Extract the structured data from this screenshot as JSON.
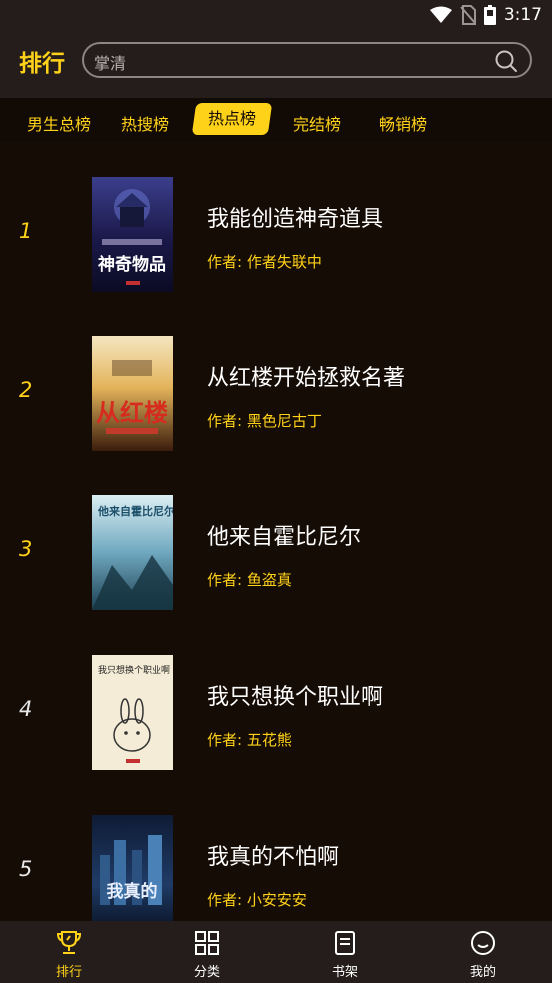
{
  "status_bar": {
    "time": "3:17",
    "icons": [
      "wifi-icon",
      "no-sim-icon",
      "battery-icon"
    ]
  },
  "header": {
    "title": "排行"
  },
  "search": {
    "text": "掌清",
    "icon": "search-icon"
  },
  "tabs": [
    {
      "label": "男生总榜",
      "active": false
    },
    {
      "label": "热搜榜",
      "active": false
    },
    {
      "label": "热点榜",
      "active": true
    },
    {
      "label": "完结榜",
      "active": false
    },
    {
      "label": "畅销榜",
      "active": false
    }
  ],
  "books": [
    {
      "rank": "1",
      "title": "我能创造神奇道具",
      "author": "作者: 作者失联中",
      "cover_text": "神奇物品"
    },
    {
      "rank": "2",
      "title": "从红楼开始拯救名著",
      "author": "作者: 黑色尼古丁",
      "cover_text": "从红楼"
    },
    {
      "rank": "3",
      "title": "他来自霍比尼尔",
      "author": "作者: 鱼盗真",
      "cover_text": "他来自霍比尼尔"
    },
    {
      "rank": "4",
      "title": "我只想换个职业啊",
      "author": "作者: 五花熊",
      "cover_text": "我只想换个职业啊"
    },
    {
      "rank": "5",
      "title": "我真的不怕啊",
      "author": "作者: 小安安安",
      "cover_text": "我真的"
    }
  ],
  "bottom_nav": [
    {
      "label": "排行",
      "icon": "trophy-icon",
      "active": true
    },
    {
      "label": "分类",
      "icon": "grid-icon",
      "active": false
    },
    {
      "label": "书架",
      "icon": "bookshelf-icon",
      "active": false
    },
    {
      "label": "我的",
      "icon": "smiley-icon",
      "active": false
    }
  ],
  "colors": {
    "accent": "#ffd21a",
    "background": "#160c06",
    "bar": "#241d1b"
  }
}
